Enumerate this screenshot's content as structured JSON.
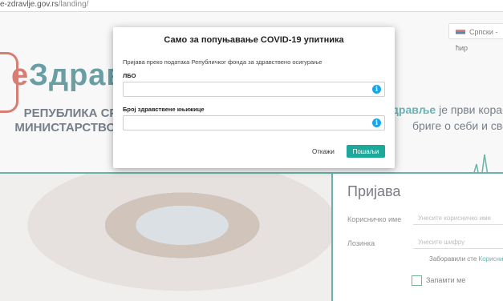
{
  "browser": {
    "url_host": "e-zdravlje.gov.rs",
    "url_path": "/landing/"
  },
  "page": {
    "language": "Српски - ћир",
    "brand_e": "е",
    "brand_rest": "Здрав",
    "ministry_line1": "РЕПУБЛИКА СР",
    "ministry_line2": "МИНИСТАРСТВО З",
    "tagline_bold": "дравље",
    "tagline_rest": " је први корак у п",
    "tagline_line2": "бриге о себи и свој",
    "login_title": "Пријава",
    "username_label": "Корисничко име",
    "username_placeholder": "Унесите корисничко име",
    "password_label": "Лозинка",
    "password_placeholder": "Унесите шифру",
    "forgot_text": "Заборавили сте ",
    "forgot_link": "Корисни",
    "remember_label": "Запамти ме"
  },
  "modal": {
    "title": "Само за попуњавање COVID-19 упитника",
    "description": "Пријава преко података Републичког фонда за здравствено осигурање",
    "field1_label": "ЛБО",
    "field2_label": "Број здравствене књижице",
    "info_glyph": "i",
    "cancel_label": "Откажи",
    "send_label": "Пошаљи"
  },
  "colors": {
    "accent": "#1da99a",
    "info": "#18a6e6",
    "brand_red": "#c0392b",
    "brand_teal": "#1a6a74"
  }
}
